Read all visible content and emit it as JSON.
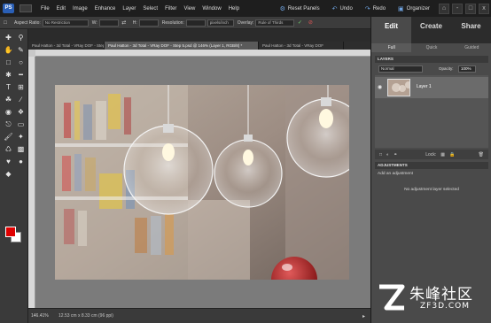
{
  "menubar": {
    "logo": "PS",
    "items": [
      "File",
      "Edit",
      "Image",
      "Enhance",
      "Layer",
      "Select",
      "Filter",
      "View",
      "Window",
      "Help"
    ],
    "actions": [
      {
        "label": "Reset Panels",
        "icon": "reset-panels-icon"
      },
      {
        "label": "Undo",
        "icon": "undo-icon"
      },
      {
        "label": "Redo",
        "icon": "redo-icon"
      },
      {
        "label": "Organizer",
        "icon": "organizer-icon"
      }
    ],
    "window_buttons": [
      "-",
      "□",
      "x"
    ]
  },
  "options": {
    "aspect_label": "Aspect Ratio:",
    "aspect_value": "No Restriction",
    "w_label": "W:",
    "h_label": "H:",
    "resolution_label": "Resolution:",
    "resolution_unit": "pixels/inch",
    "overlay_label": "Overlay:",
    "overlay_value": "Rule of Thirds"
  },
  "tabs": [
    {
      "label": "Paul Hatton - 3d Total - VRay DOF - Step 4.psd"
    },
    {
      "label": "Paul Hatton - 3d Total - VRay DOF - Step 5.psd @ 146% (Layer 1, RGB/8) *"
    },
    {
      "label": "Paul Hatton - 3d Total - VRay DOF"
    }
  ],
  "status": {
    "zoom": "146.41%",
    "info": "12.53 cm x 8.33 cm (96 ppi)"
  },
  "panel": {
    "tabs": [
      "Edit",
      "Create",
      "Share"
    ],
    "subtabs": [
      "Full",
      "Quick",
      "Guided"
    ],
    "layers_title": "LAYERS",
    "blend_mode": "Normal",
    "opacity_label": "Opacity:",
    "opacity_value": "100%",
    "layer_name": "Layer 1",
    "lock_label": "Lock:",
    "adjustments_title": "ADJUSTMENTS",
    "add_adjustment": "Add an adjustment",
    "no_layer": "No adjustment layer selected"
  },
  "watermark": {
    "cn": "朱峰社区",
    "en": "ZF3D.COM"
  },
  "colors": {
    "foreground": "#e00000",
    "background": "#ffffff",
    "accent": "#2a5fb6"
  }
}
